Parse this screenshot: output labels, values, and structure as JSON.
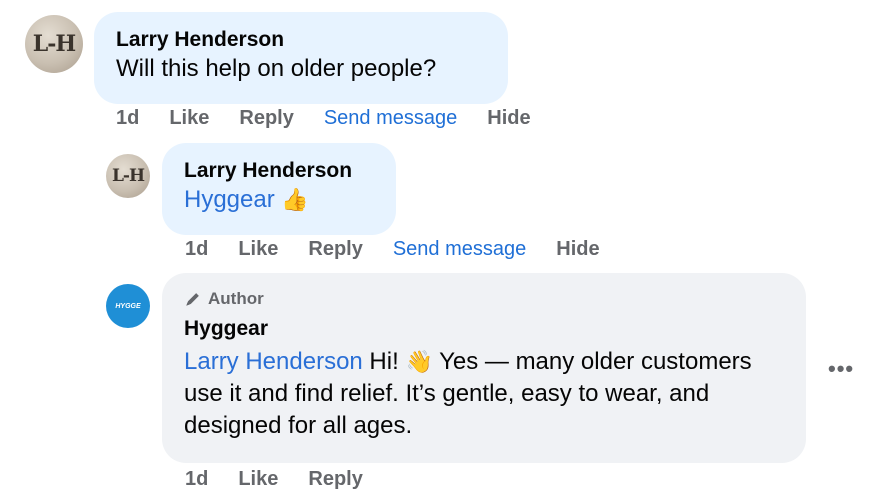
{
  "comment1": {
    "avatar_text": "L-H",
    "author": "Larry Henderson",
    "text": "Will this help on older people?",
    "actions": {
      "time": "1d",
      "like": "Like",
      "reply": "Reply",
      "send_message": "Send message",
      "hide": "Hide"
    }
  },
  "comment2": {
    "avatar_text": "L-H",
    "author": "Larry Henderson",
    "mention": "Hyggear",
    "emoji": "👍",
    "actions": {
      "time": "1d",
      "like": "Like",
      "reply": "Reply",
      "send_message": "Send message",
      "hide": "Hide"
    }
  },
  "comment3": {
    "avatar_text": "HYGGE",
    "badge": "Author",
    "author": "Hyggear",
    "mention": "Larry Henderson",
    "text_part1": " Hi! ",
    "emoji": "👋",
    "text_part2": " Yes — many older customers use it and find relief. It’s gentle, easy to wear, and designed for all ages.",
    "actions": {
      "time": "1d",
      "like": "Like",
      "reply": "Reply"
    }
  },
  "more_options": "•••"
}
